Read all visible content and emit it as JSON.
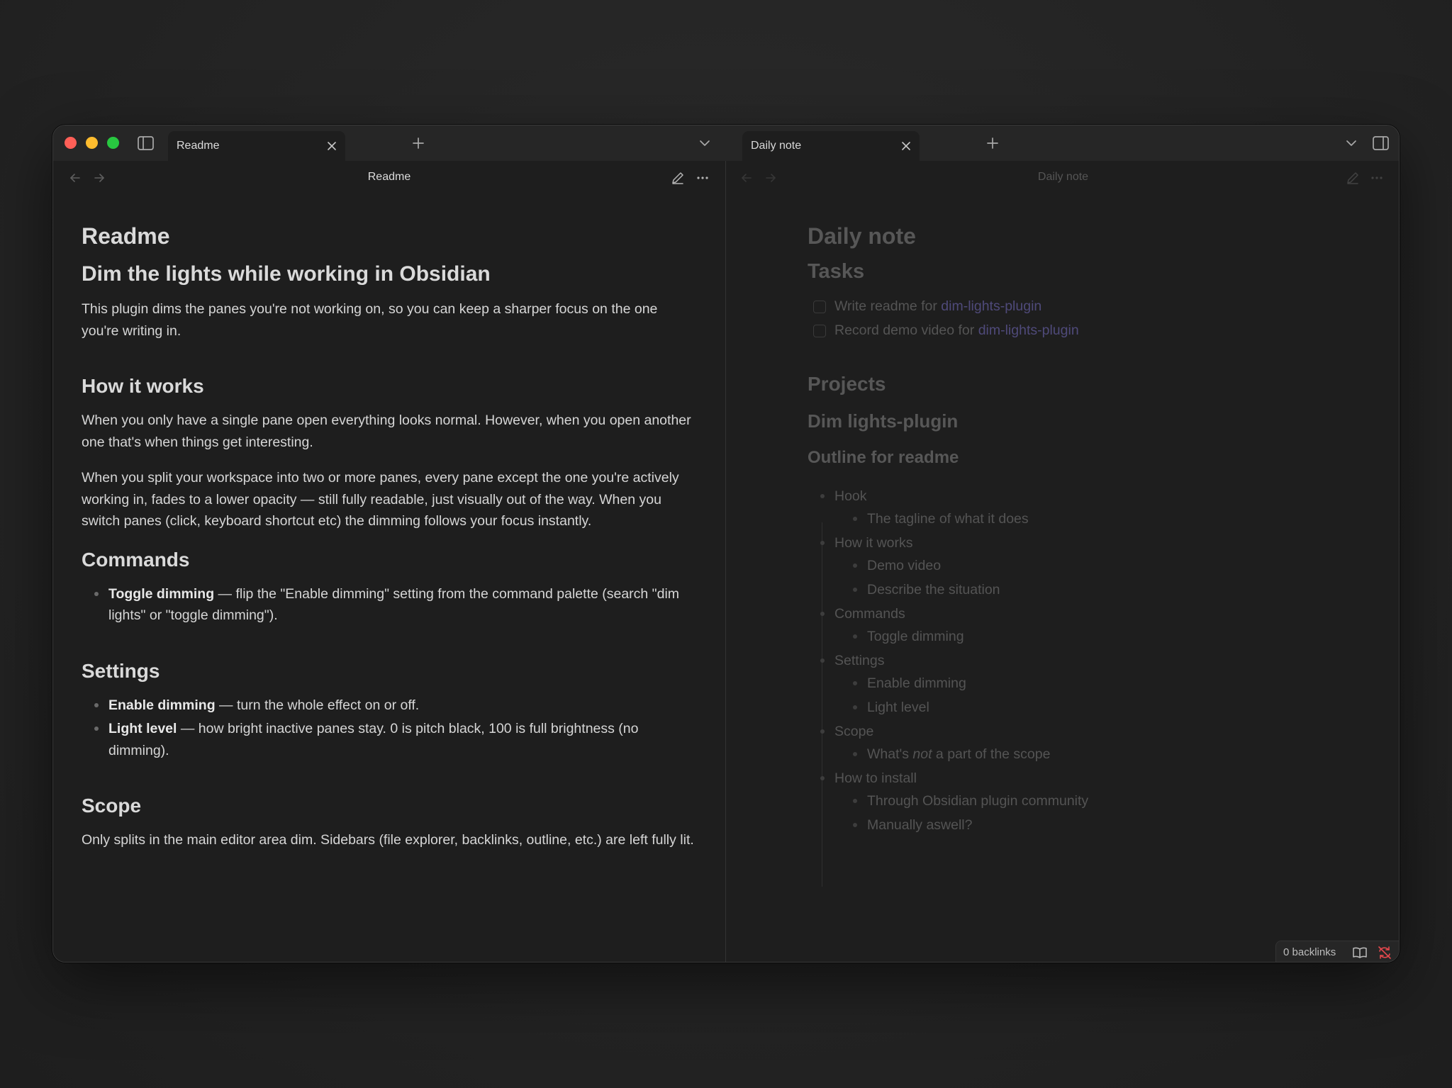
{
  "colors": {
    "traffic_red": "#ff5f57",
    "traffic_yellow": "#febc2e",
    "traffic_green": "#28c840",
    "link_dimmed": "#4f4a7a",
    "sync_error": "#e5484d"
  },
  "tabs": {
    "left": {
      "label": "Readme"
    },
    "right": {
      "label": "Daily note"
    }
  },
  "left_pane": {
    "nav_title": "Readme",
    "inline_title": "Readme",
    "h_main": "Dim the lights while working in Obsidian",
    "intro": "This plugin dims the panes you're not working on, so you can keep a sharper focus on the one you're writing in.",
    "how_heading": "How it works",
    "how_p1": "When you only have a single pane open everything looks normal. However, when you open another one that's when things get interesting.",
    "how_p2": "When you split your workspace into two or more panes, every pane except the one you're actively working in, fades to a lower opacity — still fully readable, just visually out of the way. When you switch panes (click, keyboard shortcut etc) the dimming follows your focus instantly.",
    "commands_heading": "Commands",
    "commands_items": [
      {
        "bold": "Toggle dimming",
        "rest": " — flip the \"Enable dimming\" setting from the command palette (search \"dim lights\" or \"toggle dimming\")."
      }
    ],
    "settings_heading": "Settings",
    "settings_items": [
      {
        "bold": "Enable dimming",
        "rest": " — turn the whole effect on or off."
      },
      {
        "bold": "Light level",
        "rest": " — how bright inactive panes stay. 0 is pitch black, 100 is full brightness (no dimming)."
      }
    ],
    "scope_heading": "Scope",
    "scope_p": "Only splits in the main editor area dim. Sidebars (file explorer, backlinks, outline, etc.) are left fully lit."
  },
  "right_pane": {
    "nav_title": "Daily note",
    "inline_title": "Daily note",
    "tasks_heading": "Tasks",
    "tasks": [
      {
        "text": "Write readme for ",
        "link": "dim-lights-plugin"
      },
      {
        "text": "Record demo video for ",
        "link": "dim-lights-plugin"
      }
    ],
    "projects_heading": "Projects",
    "project_heading": "Dim lights-plugin",
    "outline_heading": "Outline for readme",
    "outline": [
      {
        "label": "Hook",
        "children": [
          "The tagline of what it does"
        ]
      },
      {
        "label": "How it works",
        "children": [
          "Demo video",
          "Describe the situation"
        ]
      },
      {
        "label": "Commands",
        "children": [
          "Toggle dimming"
        ]
      },
      {
        "label": "Settings",
        "children": [
          "Enable dimming",
          "Light level"
        ]
      },
      {
        "label": "Scope",
        "children_rich": [
          {
            "pre": "What's ",
            "em": "not",
            "post": " a part of the scope"
          }
        ]
      },
      {
        "label": "How to install",
        "children": [
          "Through Obsidian plugin community",
          "Manually aswell?"
        ]
      }
    ]
  },
  "status_bar": {
    "backlinks": "0 backlinks",
    "icons": [
      "reading-mode-icon",
      "sync-error-icon"
    ]
  }
}
